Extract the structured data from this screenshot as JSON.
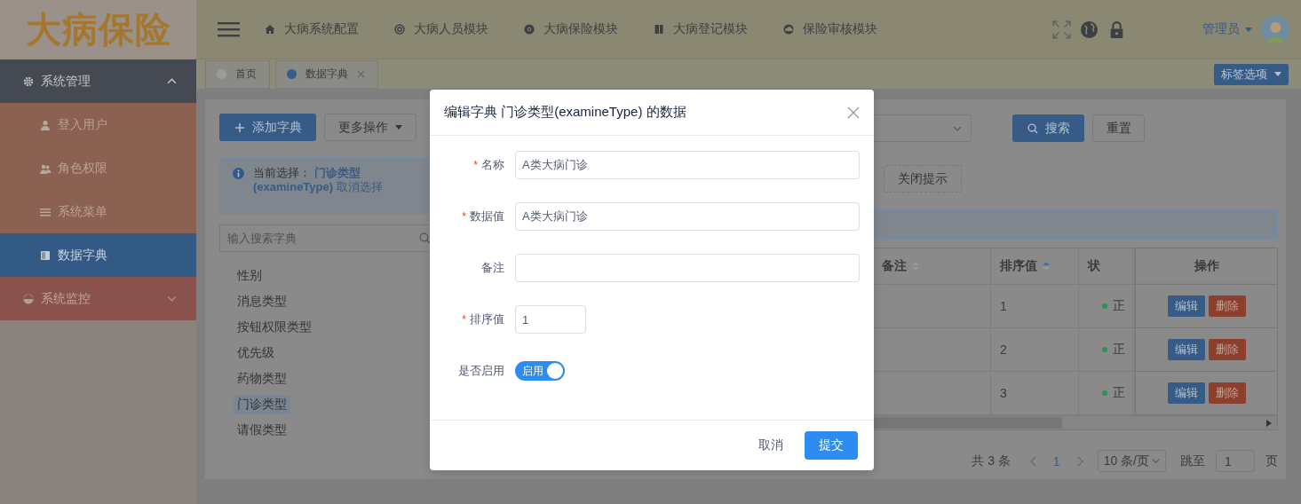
{
  "sidebar": {
    "logo": "大病保险",
    "menu": [
      {
        "label": "系统管理",
        "expanded": true,
        "children": [
          {
            "label": "登入用户",
            "selected": false
          },
          {
            "label": "角色权限",
            "selected": false
          },
          {
            "label": "系统菜单",
            "selected": false
          },
          {
            "label": "数据字典",
            "selected": true
          }
        ]
      },
      {
        "label": "系统监控",
        "expanded": false
      }
    ]
  },
  "header": {
    "nav": [
      {
        "label": "大病系统配置"
      },
      {
        "label": "大病人员模块"
      },
      {
        "label": "大病保险模块"
      },
      {
        "label": "大病登记模块"
      },
      {
        "label": "保险审核模块"
      }
    ],
    "user": "管理员"
  },
  "tabs": [
    {
      "label": "首页",
      "selected": false,
      "closable": false
    },
    {
      "label": "数据字典",
      "selected": true,
      "closable": true
    }
  ],
  "tab_options": "标签选项",
  "toolbar": {
    "add_button": "添加字典",
    "more_button": "更多操作",
    "search_button": "搜索",
    "reset_button": "重置",
    "close_tip_button": "关闭提示"
  },
  "selection_alert": {
    "prefix": "当前选择：",
    "selection": "门诊类型(examineType)",
    "action": "取消选择"
  },
  "dict_search": {
    "placeholder": "输入搜索字典"
  },
  "dict_list": [
    {
      "label": "性别",
      "selected": false
    },
    {
      "label": "消息类型",
      "selected": false
    },
    {
      "label": "按钮权限类型",
      "selected": false
    },
    {
      "label": "优先级",
      "selected": false
    },
    {
      "label": "药物类型",
      "selected": false
    },
    {
      "label": "门诊类型",
      "selected": true
    },
    {
      "label": "请假类型",
      "selected": false
    }
  ],
  "table": {
    "columns": [
      {
        "label": "备注",
        "sortable": true,
        "sort_ascending": false
      },
      {
        "label": "排序值",
        "sortable": true,
        "sort_ascending": true
      },
      {
        "label": "状",
        "sortable": false
      },
      {
        "label": "操作",
        "sortable": false
      }
    ],
    "rows": [
      {
        "sort_value": "1",
        "status": "正",
        "color": "#2f8f5a",
        "actions": [
          "编辑",
          "删除"
        ]
      },
      {
        "sort_value": "2",
        "status": "正",
        "color": "#2f8f5a",
        "actions": [
          "编辑",
          "删除"
        ]
      },
      {
        "sort_value": "3",
        "status": "正",
        "color": "#2f8f5a",
        "actions": [
          "编辑",
          "删除"
        ]
      }
    ]
  },
  "pagination": {
    "total": "共 3 条",
    "pages": [
      {
        "label": "1",
        "selected": true
      }
    ],
    "page_size": "10 条/页",
    "jump_label": "跳至",
    "jump_value": "1",
    "jump_suffix": "页"
  },
  "modal": {
    "title": "编辑字典 门诊类型(examineType) 的数据",
    "fields": [
      {
        "label": "名称",
        "required_mark": "*",
        "kind": "text",
        "value": "A类大病门诊"
      },
      {
        "label": "数据值",
        "required_mark": "*",
        "kind": "text",
        "value": "A类大病门诊"
      },
      {
        "label": "备注",
        "kind": "text"
      },
      {
        "label": "排序值",
        "required_mark": "*",
        "kind": "number",
        "value": "1"
      },
      {
        "label": "是否启用",
        "kind": "switch",
        "on": true,
        "text": "启用"
      }
    ],
    "cancel_button": "取消",
    "submit_button": "提交"
  }
}
